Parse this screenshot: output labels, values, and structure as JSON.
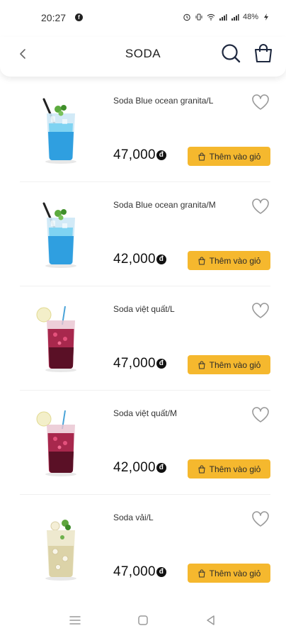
{
  "status_bar": {
    "time": "20:27",
    "battery": "48%",
    "icons": [
      "alarm-icon",
      "vibrate-icon",
      "wifi-icon",
      "signal-icon",
      "signal-icon",
      "battery-icon"
    ]
  },
  "header": {
    "title": "SODA",
    "back_icon": "chevron-left-icon",
    "search_icon": "search-icon",
    "cart_icon": "shopping-bag-icon"
  },
  "colors": {
    "accent": "#f5b82e",
    "blue_drink": "#2f9fe0",
    "berry_drink": "#8a1c3a",
    "lychee_drink": "#e8e2c6"
  },
  "products": [
    {
      "name": "Soda Blue ocean granita/L",
      "price": "47,000",
      "currency": "đ",
      "button": "Thêm vào giỏ",
      "drink": "blue"
    },
    {
      "name": "Soda Blue ocean granita/M",
      "price": "42,000",
      "currency": "đ",
      "button": "Thêm vào giỏ",
      "drink": "blue"
    },
    {
      "name": "Soda việt quất/L",
      "price": "47,000",
      "currency": "đ",
      "button": "Thêm vào giỏ",
      "drink": "berry"
    },
    {
      "name": "Soda việt quất/M",
      "price": "42,000",
      "currency": "đ",
      "button": "Thêm vào giỏ",
      "drink": "berry"
    },
    {
      "name": "Soda vải/L",
      "price": "47,000",
      "currency": "đ",
      "button": "Thêm vào giỏ",
      "drink": "lychee"
    }
  ],
  "system_nav": [
    "menu-icon",
    "home-square-icon",
    "back-triangle-icon"
  ]
}
